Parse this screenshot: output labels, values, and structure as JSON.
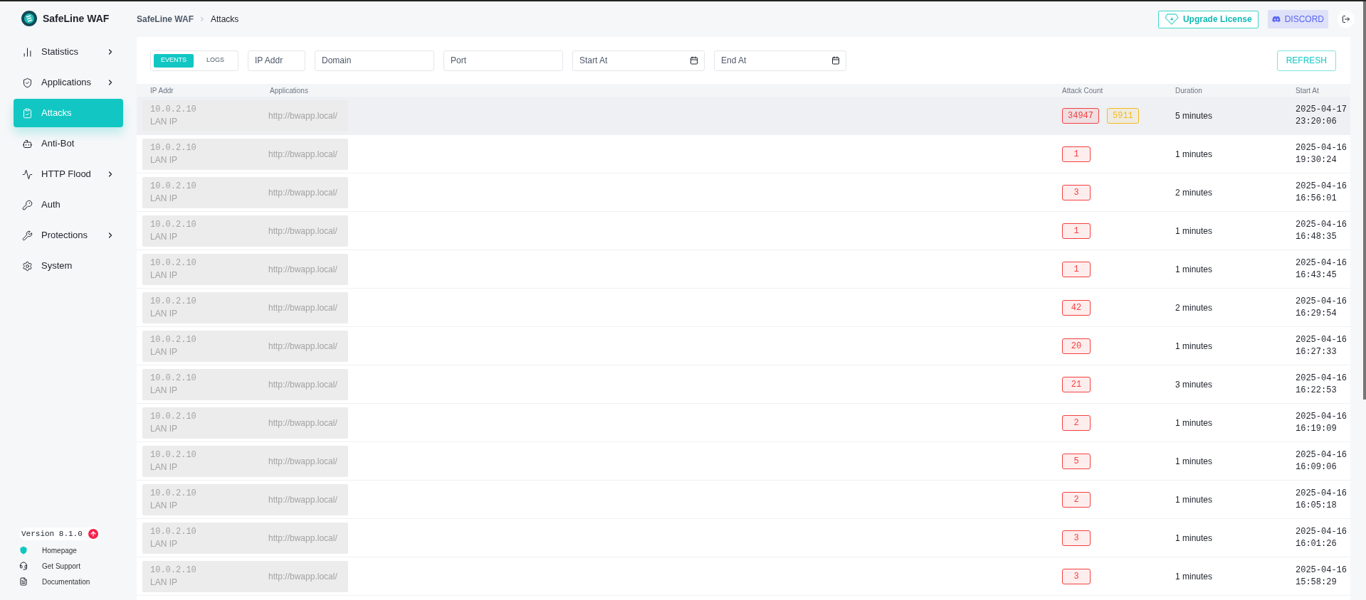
{
  "brand": {
    "name": "SafeLine WAF"
  },
  "breadcrumb": [
    "SafeLine WAF",
    "Attacks"
  ],
  "header": {
    "upgrade": "Upgrade License",
    "discord": "DISCORD"
  },
  "sidebar": {
    "items": [
      {
        "kind": "statistics",
        "label": "Statistics",
        "selected": false,
        "expandable": true
      },
      {
        "kind": "applications",
        "label": "Applications",
        "selected": false,
        "expandable": true
      },
      {
        "kind": "attacks",
        "label": "Attacks",
        "selected": true,
        "expandable": false
      },
      {
        "kind": "antibot",
        "label": "Anti-Bot",
        "selected": false,
        "expandable": false
      },
      {
        "kind": "flood",
        "label": "HTTP Flood",
        "selected": false,
        "expandable": true
      },
      {
        "kind": "auth",
        "label": "Auth",
        "selected": false,
        "expandable": false
      },
      {
        "kind": "protections",
        "label": "Protections",
        "selected": false,
        "expandable": true
      },
      {
        "kind": "system",
        "label": "System",
        "selected": false,
        "expandable": false
      }
    ],
    "version": "Version 8.1.0",
    "links": [
      {
        "kind": "home",
        "label": "Homepage"
      },
      {
        "kind": "support",
        "label": "Get Support"
      },
      {
        "kind": "docs",
        "label": "Documentation"
      }
    ]
  },
  "filters": {
    "tabs": [
      {
        "label": "EVENTS",
        "selected": true
      },
      {
        "label": "LOGS",
        "selected": false
      }
    ],
    "fields": [
      {
        "kind": "text",
        "placeholder": "IP Addr"
      },
      {
        "kind": "text",
        "placeholder": "Domain"
      },
      {
        "kind": "text",
        "placeholder": "Port"
      },
      {
        "kind": "date",
        "placeholder": "Start At"
      },
      {
        "kind": "date",
        "placeholder": "End At"
      }
    ],
    "refresh": "REFRESH"
  },
  "table": {
    "columns": [
      "IP Addr",
      "Applications",
      "Attack Count",
      "Duration",
      "Start At"
    ],
    "rows": [
      {
        "ip": "10.0.2.10",
        "ip_type": "LAN IP",
        "app": "http://bwapp.local/",
        "selected": true,
        "counts": [
          {
            "value": "34947",
            "color": "#f53f3f"
          },
          {
            "value": "5911",
            "color": "#f7ba1e"
          }
        ],
        "duration": "5 minutes",
        "date": "2025-04-17",
        "time": "23:20:06"
      },
      {
        "ip": "10.0.2.10",
        "ip_type": "LAN IP",
        "app": "http://bwapp.local/",
        "selected": false,
        "counts": [
          {
            "value": "1",
            "color": "#f53f3f"
          }
        ],
        "duration": "1 minutes",
        "date": "2025-04-16",
        "time": "19:30:24"
      },
      {
        "ip": "10.0.2.10",
        "ip_type": "LAN IP",
        "app": "http://bwapp.local/",
        "selected": false,
        "counts": [
          {
            "value": "3",
            "color": "#f53f3f"
          }
        ],
        "duration": "2 minutes",
        "date": "2025-04-16",
        "time": "16:56:01"
      },
      {
        "ip": "10.0.2.10",
        "ip_type": "LAN IP",
        "app": "http://bwapp.local/",
        "selected": false,
        "counts": [
          {
            "value": "1",
            "color": "#f53f3f"
          }
        ],
        "duration": "1 minutes",
        "date": "2025-04-16",
        "time": "16:48:35"
      },
      {
        "ip": "10.0.2.10",
        "ip_type": "LAN IP",
        "app": "http://bwapp.local/",
        "selected": false,
        "counts": [
          {
            "value": "1",
            "color": "#f53f3f"
          }
        ],
        "duration": "1 minutes",
        "date": "2025-04-16",
        "time": "16:43:45"
      },
      {
        "ip": "10.0.2.10",
        "ip_type": "LAN IP",
        "app": "http://bwapp.local/",
        "selected": false,
        "counts": [
          {
            "value": "42",
            "color": "#f53f3f"
          }
        ],
        "duration": "2 minutes",
        "date": "2025-04-16",
        "time": "16:29:54"
      },
      {
        "ip": "10.0.2.10",
        "ip_type": "LAN IP",
        "app": "http://bwapp.local/",
        "selected": false,
        "counts": [
          {
            "value": "20",
            "color": "#f53f3f"
          }
        ],
        "duration": "1 minutes",
        "date": "2025-04-16",
        "time": "16:27:33"
      },
      {
        "ip": "10.0.2.10",
        "ip_type": "LAN IP",
        "app": "http://bwapp.local/",
        "selected": false,
        "counts": [
          {
            "value": "21",
            "color": "#f53f3f"
          }
        ],
        "duration": "3 minutes",
        "date": "2025-04-16",
        "time": "16:22:53"
      },
      {
        "ip": "10.0.2.10",
        "ip_type": "LAN IP",
        "app": "http://bwapp.local/",
        "selected": false,
        "counts": [
          {
            "value": "2",
            "color": "#f53f3f"
          }
        ],
        "duration": "1 minutes",
        "date": "2025-04-16",
        "time": "16:19:09"
      },
      {
        "ip": "10.0.2.10",
        "ip_type": "LAN IP",
        "app": "http://bwapp.local/",
        "selected": false,
        "counts": [
          {
            "value": "5",
            "color": "#f53f3f"
          }
        ],
        "duration": "1 minutes",
        "date": "2025-04-16",
        "time": "16:09:06"
      },
      {
        "ip": "10.0.2.10",
        "ip_type": "LAN IP",
        "app": "http://bwapp.local/",
        "selected": false,
        "counts": [
          {
            "value": "2",
            "color": "#f53f3f"
          }
        ],
        "duration": "1 minutes",
        "date": "2025-04-16",
        "time": "16:05:18"
      },
      {
        "ip": "10.0.2.10",
        "ip_type": "LAN IP",
        "app": "http://bwapp.local/",
        "selected": false,
        "counts": [
          {
            "value": "3",
            "color": "#f53f3f"
          }
        ],
        "duration": "1 minutes",
        "date": "2025-04-16",
        "time": "16:01:26"
      },
      {
        "ip": "10.0.2.10",
        "ip_type": "LAN IP",
        "app": "http://bwapp.local/",
        "selected": false,
        "counts": [
          {
            "value": "3",
            "color": "#f53f3f"
          }
        ],
        "duration": "1 minutes",
        "date": "2025-04-16",
        "time": "15:58:29"
      }
    ]
  }
}
